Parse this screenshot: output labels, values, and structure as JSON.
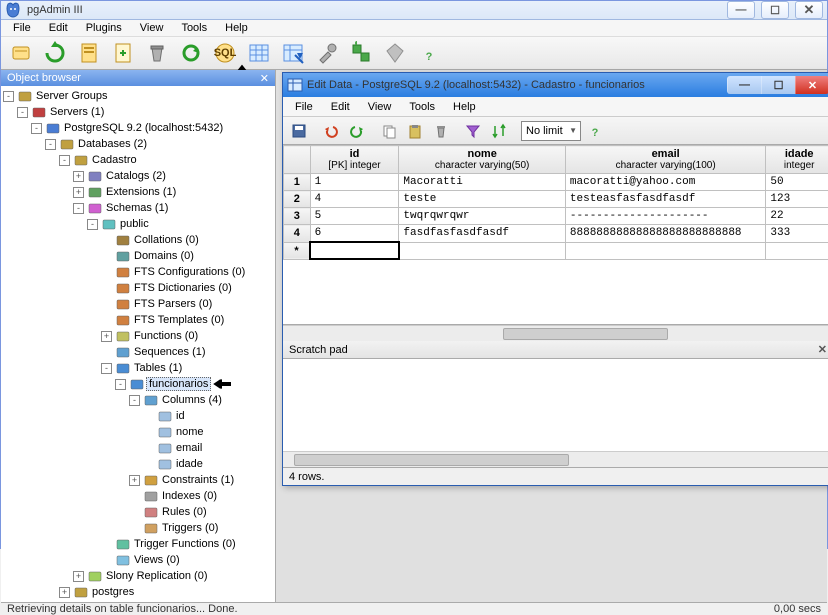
{
  "app": {
    "title": "pgAdmin III"
  },
  "main_menu": [
    "File",
    "Edit",
    "Plugins",
    "View",
    "Tools",
    "Help"
  ],
  "object_browser": {
    "title": "Object browser",
    "tree": [
      {
        "level": 0,
        "toggle": "-",
        "icon": "server-group",
        "label": "Server Groups"
      },
      {
        "level": 1,
        "toggle": "-",
        "icon": "server",
        "label": "Servers (1)"
      },
      {
        "level": 2,
        "toggle": "-",
        "icon": "pg-server",
        "label": "PostgreSQL 9.2 (localhost:5432)"
      },
      {
        "level": 3,
        "toggle": "-",
        "icon": "databases",
        "label": "Databases (2)"
      },
      {
        "level": 4,
        "toggle": "-",
        "icon": "database",
        "label": "Cadastro"
      },
      {
        "level": 5,
        "toggle": "+",
        "icon": "catalog",
        "label": "Catalogs (2)"
      },
      {
        "level": 5,
        "toggle": "+",
        "icon": "extension",
        "label": "Extensions (1)"
      },
      {
        "level": 5,
        "toggle": "-",
        "icon": "schemas",
        "label": "Schemas (1)"
      },
      {
        "level": 6,
        "toggle": "-",
        "icon": "schema",
        "label": "public"
      },
      {
        "level": 7,
        "toggle": "",
        "icon": "collation",
        "label": "Collations (0)"
      },
      {
        "level": 7,
        "toggle": "",
        "icon": "domain",
        "label": "Domains (0)"
      },
      {
        "level": 7,
        "toggle": "",
        "icon": "fts",
        "label": "FTS Configurations (0)"
      },
      {
        "level": 7,
        "toggle": "",
        "icon": "fts",
        "label": "FTS Dictionaries (0)"
      },
      {
        "level": 7,
        "toggle": "",
        "icon": "fts",
        "label": "FTS Parsers (0)"
      },
      {
        "level": 7,
        "toggle": "",
        "icon": "fts",
        "label": "FTS Templates (0)"
      },
      {
        "level": 7,
        "toggle": "+",
        "icon": "function",
        "label": "Functions (0)"
      },
      {
        "level": 7,
        "toggle": "",
        "icon": "sequence",
        "label": "Sequences (1)"
      },
      {
        "level": 7,
        "toggle": "-",
        "icon": "table",
        "label": "Tables (1)"
      },
      {
        "level": 8,
        "toggle": "-",
        "icon": "table",
        "label": "funcionarios",
        "selected": true
      },
      {
        "level": 9,
        "toggle": "-",
        "icon": "columns",
        "label": "Columns (4)"
      },
      {
        "level": 10,
        "toggle": "",
        "icon": "column",
        "label": "id"
      },
      {
        "level": 10,
        "toggle": "",
        "icon": "column",
        "label": "nome"
      },
      {
        "level": 10,
        "toggle": "",
        "icon": "column",
        "label": "email"
      },
      {
        "level": 10,
        "toggle": "",
        "icon": "column",
        "label": "idade"
      },
      {
        "level": 9,
        "toggle": "+",
        "icon": "constraint",
        "label": "Constraints (1)"
      },
      {
        "level": 9,
        "toggle": "",
        "icon": "index",
        "label": "Indexes (0)"
      },
      {
        "level": 9,
        "toggle": "",
        "icon": "rule",
        "label": "Rules (0)"
      },
      {
        "level": 9,
        "toggle": "",
        "icon": "trigger",
        "label": "Triggers (0)"
      },
      {
        "level": 7,
        "toggle": "",
        "icon": "trigger-fn",
        "label": "Trigger Functions (0)"
      },
      {
        "level": 7,
        "toggle": "",
        "icon": "view",
        "label": "Views (0)"
      },
      {
        "level": 5,
        "toggle": "+",
        "icon": "slony",
        "label": "Slony Replication (0)"
      },
      {
        "level": 4,
        "toggle": "+",
        "icon": "database",
        "label": "postgres"
      }
    ]
  },
  "edit_window": {
    "title": "Edit Data - PostgreSQL 9.2 (localhost:5432) - Cadastro - funcionarios",
    "menu": [
      "File",
      "Edit",
      "View",
      "Tools",
      "Help"
    ],
    "limit_label": "No limit",
    "columns": [
      {
        "name": "id",
        "type": "[PK] integer"
      },
      {
        "name": "nome",
        "type": "character varying(50)"
      },
      {
        "name": "email",
        "type": "character varying(100)"
      },
      {
        "name": "idade",
        "type": "integer"
      }
    ],
    "rows": [
      {
        "n": "1",
        "id": "1",
        "nome": "Macoratti",
        "email": "macoratti@yahoo.com",
        "idade": "50"
      },
      {
        "n": "2",
        "id": "4",
        "nome": "teste",
        "email": "testeasfasfasdfasdf",
        "idade": "123"
      },
      {
        "n": "3",
        "id": "5",
        "nome": "twqrqwrqwr",
        "email": "---------------------",
        "idade": "22"
      },
      {
        "n": "4",
        "id": "6",
        "nome": "fasdfasfasdfasdf",
        "email": "88888888888888888888888888",
        "idade": "333"
      }
    ],
    "new_row_marker": "*",
    "scratch_label": "Scratch pad",
    "status": "4 rows."
  },
  "statusbar": {
    "text": "Retrieving details on table funcionarios... Done.",
    "time": "0,00 secs"
  },
  "colors": {
    "accent": "#5a8fe0"
  }
}
